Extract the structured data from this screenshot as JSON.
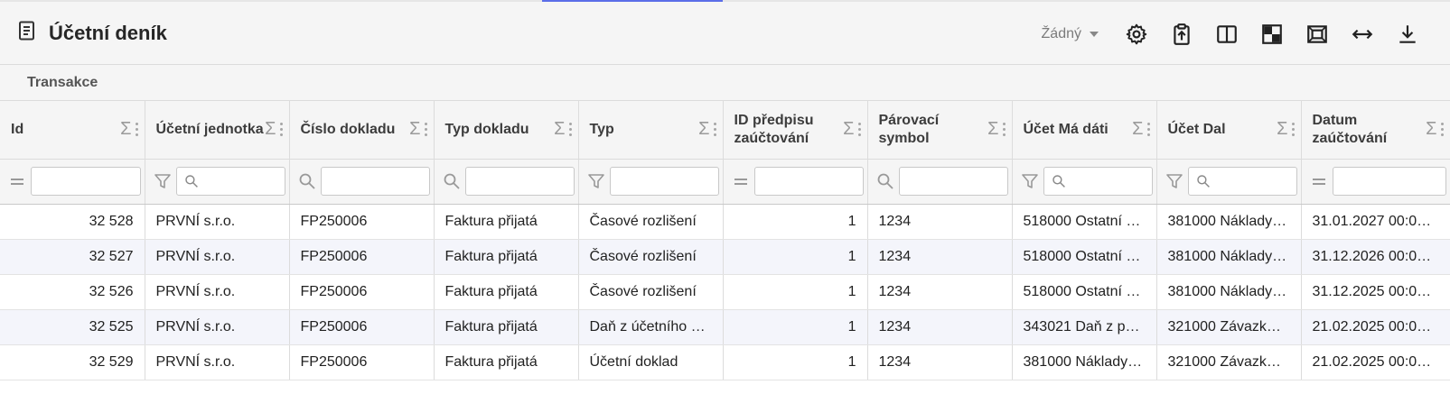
{
  "header": {
    "title": "Účetní deník",
    "select_value": "Žádný"
  },
  "toolbar": {
    "icons": [
      "gear-icon",
      "clipboard-upload-icon",
      "split-columns-icon",
      "checker-icon",
      "fit-frame-icon",
      "expand-horizontal-icon",
      "download-icon"
    ]
  },
  "tabs": [
    "Transakce"
  ],
  "columns": [
    {
      "label": "Id",
      "filter": "equals"
    },
    {
      "label": "Účetní jednotka",
      "filter": "funnel-search"
    },
    {
      "label": "Číslo dokladu",
      "filter": "search"
    },
    {
      "label": "Typ dokladu",
      "filter": "search"
    },
    {
      "label": "Typ",
      "filter": "funnel"
    },
    {
      "label": "ID předpisu zaúčtování",
      "filter": "equals"
    },
    {
      "label": "Párovací symbol",
      "filter": "search"
    },
    {
      "label": "Účet Má dáti",
      "filter": "funnel-search"
    },
    {
      "label": "Účet Dal",
      "filter": "funnel-search"
    },
    {
      "label": "Datum zaúčtování",
      "filter": "equals"
    }
  ],
  "rows": [
    {
      "id": "32 528",
      "unit": "PRVNÍ s.r.o.",
      "doc": "FP250006",
      "doctype": "Faktura přijatá",
      "type": "Časové rozlišení",
      "rule": "1",
      "pair": "1234",
      "debit": "518000 Ostatní …",
      "credit": "381000 Náklady…",
      "date": "31.01.2027 00:0…"
    },
    {
      "id": "32 527",
      "unit": "PRVNÍ s.r.o.",
      "doc": "FP250006",
      "doctype": "Faktura přijatá",
      "type": "Časové rozlišení",
      "rule": "1",
      "pair": "1234",
      "debit": "518000 Ostatní …",
      "credit": "381000 Náklady…",
      "date": "31.12.2026 00:0…"
    },
    {
      "id": "32 526",
      "unit": "PRVNÍ s.r.o.",
      "doc": "FP250006",
      "doctype": "Faktura přijatá",
      "type": "Časové rozlišení",
      "rule": "1",
      "pair": "1234",
      "debit": "518000 Ostatní …",
      "credit": "381000 Náklady…",
      "date": "31.12.2025 00:0…"
    },
    {
      "id": "32 525",
      "unit": "PRVNÍ s.r.o.",
      "doc": "FP250006",
      "doctype": "Faktura přijatá",
      "type": "Daň z účetního …",
      "rule": "1",
      "pair": "1234",
      "debit": "343021 Daň z p…",
      "credit": "321000 Závazk…",
      "date": "21.02.2025 00:0…"
    },
    {
      "id": "32 529",
      "unit": "PRVNÍ s.r.o.",
      "doc": "FP250006",
      "doctype": "Faktura přijatá",
      "type": "Účetní doklad",
      "rule": "1",
      "pair": "1234",
      "debit": "381000 Náklady…",
      "credit": "321000 Závazk…",
      "date": "21.02.2025 00:0…"
    }
  ]
}
